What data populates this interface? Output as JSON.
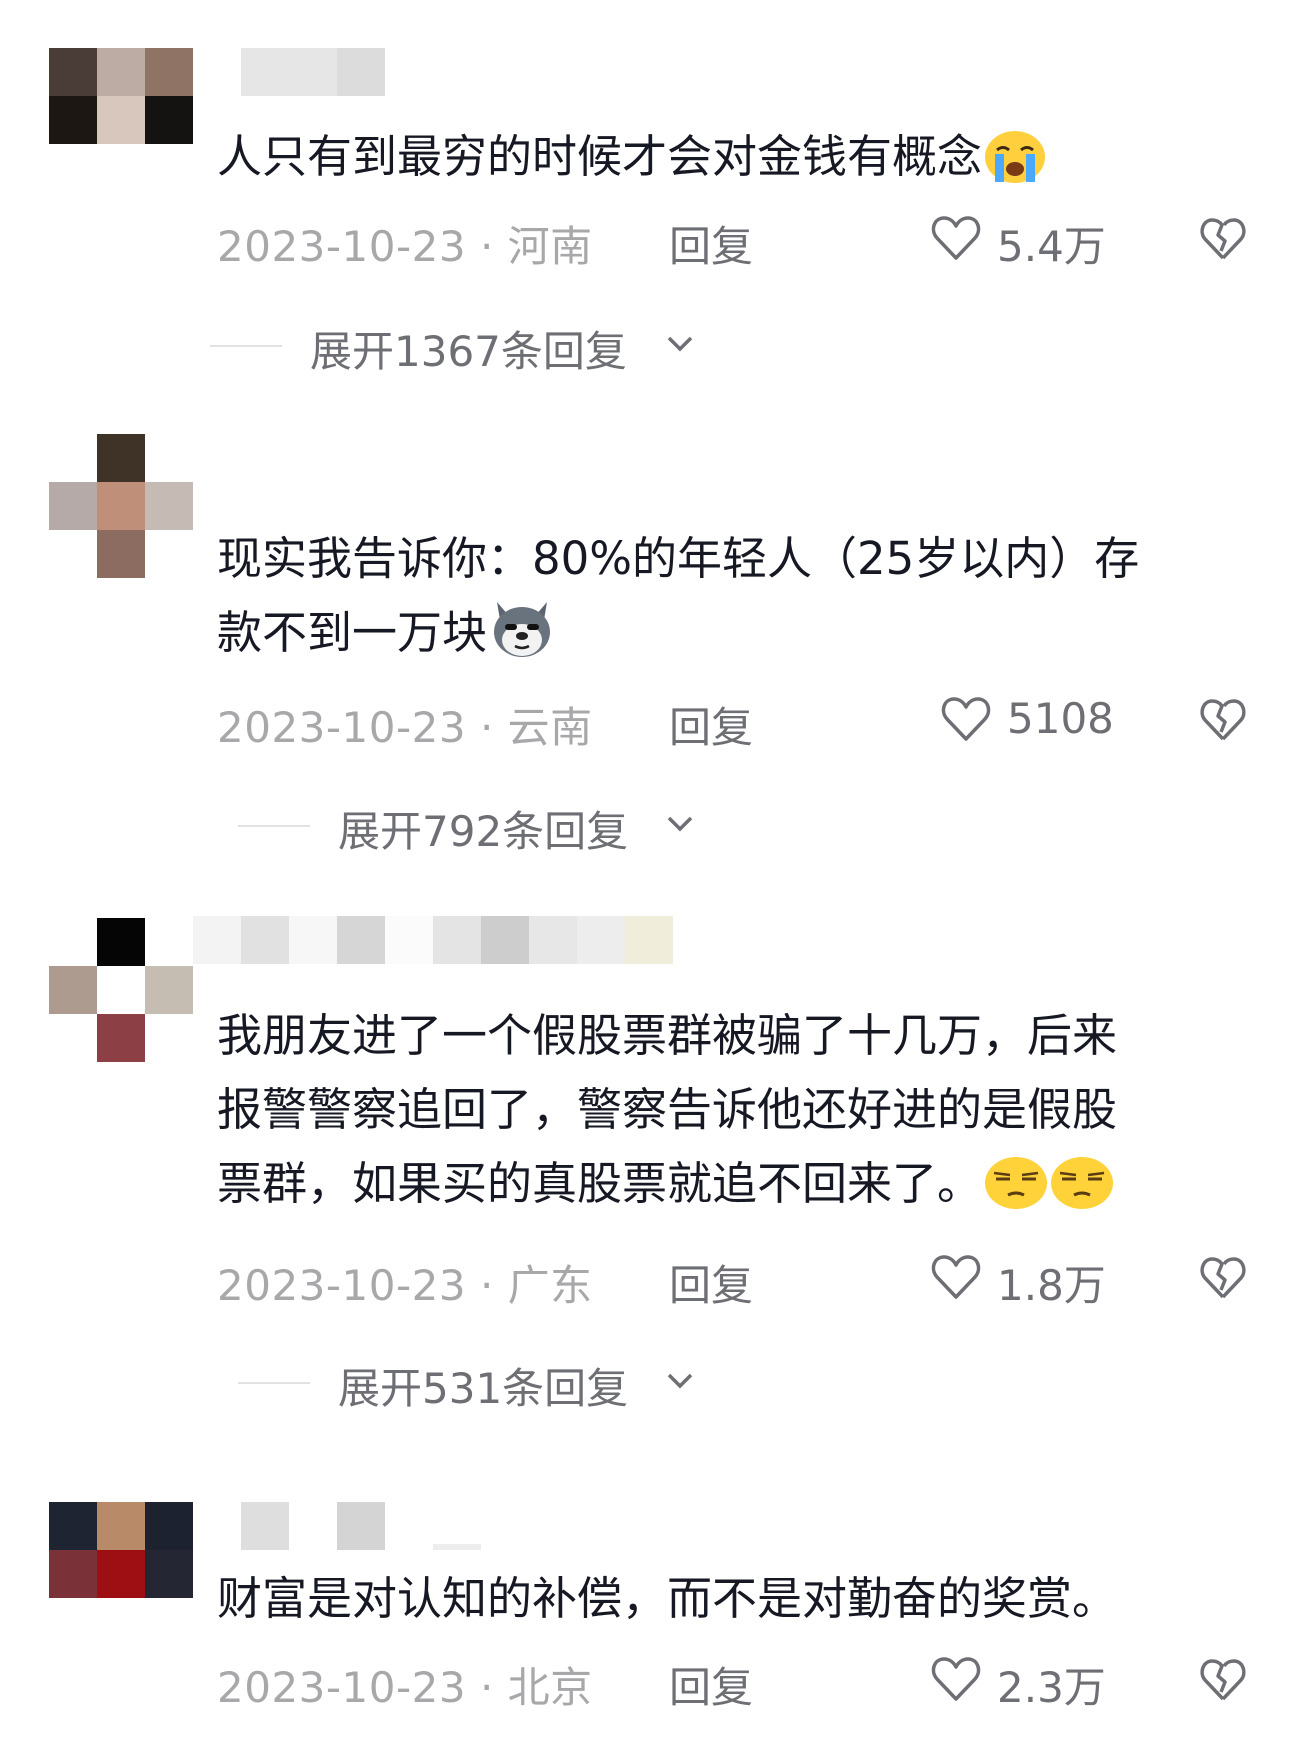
{
  "comments": [
    {
      "text": "人只有到最穷的时候才会对金钱有概念",
      "emojis": [
        "crying-face"
      ],
      "date": "2023-10-23",
      "location": "河南",
      "reply_label": "回复",
      "likes": "5.4万",
      "expand_label": "展开1367条回复"
    },
    {
      "text_line1": "现实我告诉你：80%的年轻人（25岁以内）存",
      "text_line2": "款不到一万块",
      "emojis": [
        "doge-husky"
      ],
      "date": "2023-10-23",
      "location": "云南",
      "reply_label": "回复",
      "likes": "5108",
      "expand_label": "展开792条回复"
    },
    {
      "text_line1": "我朋友进了一个假股票群被骗了十几万，后来",
      "text_line2": "报警警察追回了，警察告诉他还好进的是假股",
      "text_line3": "票群，如果买的真股票就追不回来了。",
      "emojis": [
        "smirk-face",
        "smirk-face"
      ],
      "date": "2023-10-23",
      "location": "广东",
      "reply_label": "回复",
      "likes": "1.8万",
      "expand_label": "展开531条回复"
    },
    {
      "text": "财富是对认知的补偿，而不是对勤奋的奖赏。",
      "date": "2023-10-23",
      "location": "北京",
      "reply_label": "回复",
      "likes": "2.3万"
    }
  ],
  "separator": "·",
  "icons": {
    "like": "heart-outline-icon",
    "dislike": "broken-heart-icon",
    "expand": "chevron-down-icon"
  },
  "colors": {
    "text": "#161823",
    "meta": "#a8a8ab",
    "action": "#6e6f74"
  }
}
